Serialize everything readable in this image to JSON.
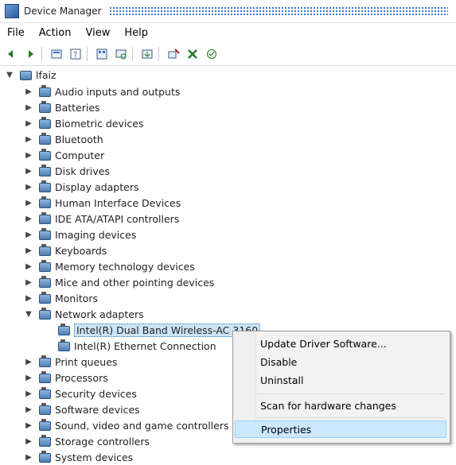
{
  "window": {
    "title": "Device Manager",
    "app_icon": "device-manager-icon"
  },
  "menu": [
    "File",
    "Action",
    "View",
    "Help"
  ],
  "toolbar": [
    "back-icon",
    "forward-icon",
    "properties-icon",
    "help-icon",
    "view-icon",
    "scan-icon",
    "update-driver-icon",
    "uninstall-icon",
    "disable-icon",
    "enable-icon"
  ],
  "tree": {
    "root": "lfaiz",
    "categories": [
      "Audio inputs and outputs",
      "Batteries",
      "Biometric devices",
      "Bluetooth",
      "Computer",
      "Disk drives",
      "Display adapters",
      "Human Interface Devices",
      "IDE ATA/ATAPI controllers",
      "Imaging devices",
      "Keyboards",
      "Memory technology devices",
      "Mice and other pointing devices",
      "Monitors",
      "Network adapters"
    ],
    "network_children": [
      "Intel(R) Dual Band Wireless-AC 3160",
      "Intel(R) Ethernet Connection"
    ],
    "after": [
      "Print queues",
      "Processors",
      "Security devices",
      "Software devices",
      "Sound, video and game controllers",
      "Storage controllers",
      "System devices"
    ]
  },
  "context_menu": {
    "update": "Update Driver Software...",
    "disable": "Disable",
    "uninstall": "Uninstall",
    "scan": "Scan for hardware changes",
    "properties": "Properties"
  },
  "colors": {
    "selection": "#cce4f7",
    "menu_hover": "#cce8ff",
    "accent": "#3b73c7"
  }
}
